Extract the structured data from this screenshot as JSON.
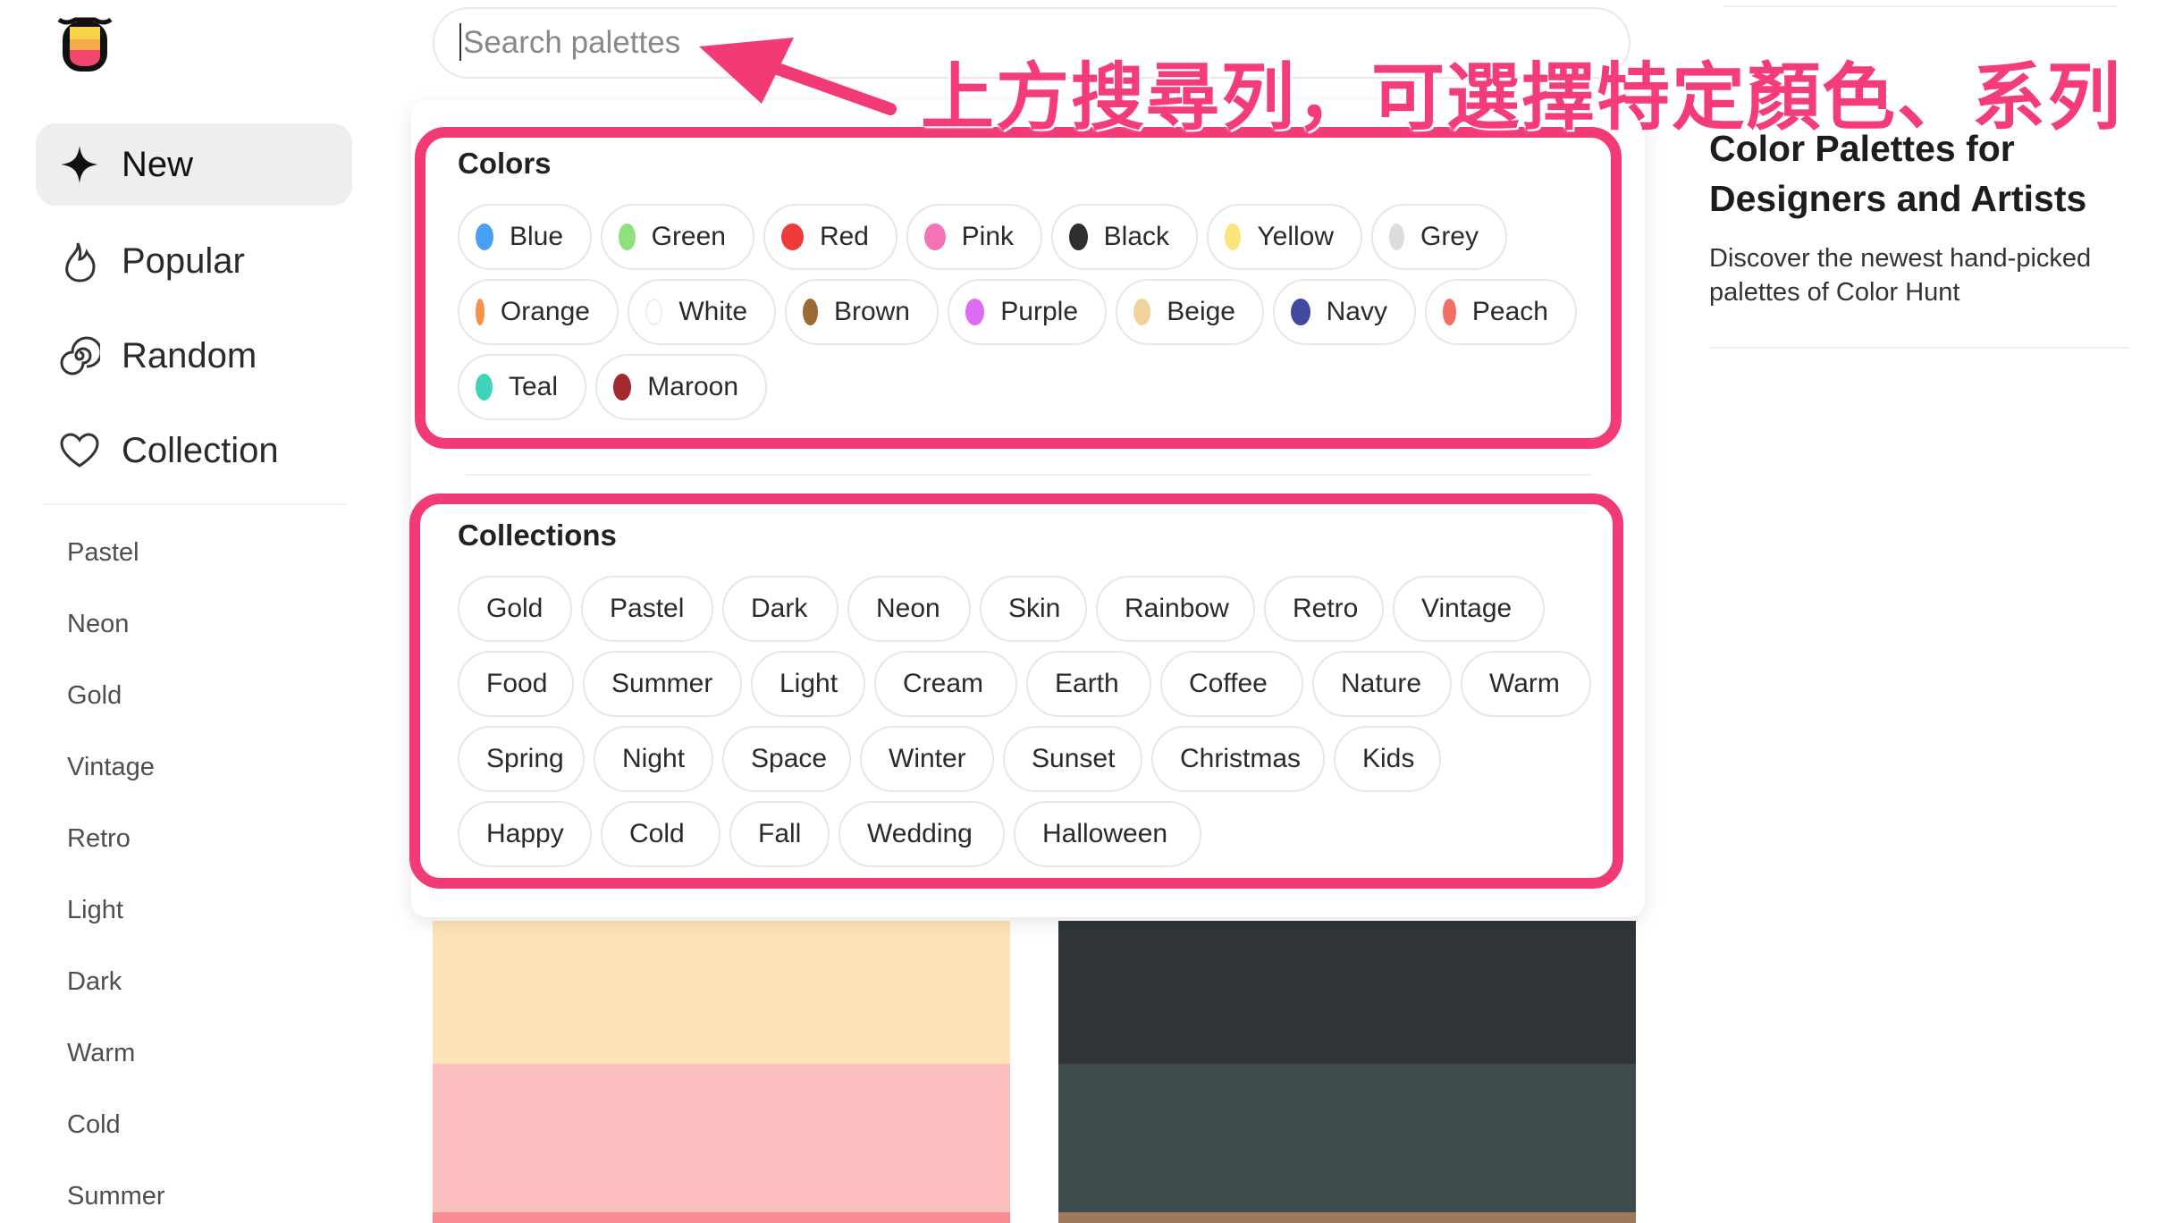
{
  "search": {
    "placeholder": "Search palettes"
  },
  "annotation": {
    "text": "上方搜尋列，可選擇特定顏色、系列"
  },
  "nav": [
    {
      "label": "New",
      "icon": "sparkle-icon",
      "active": true
    },
    {
      "label": "Popular",
      "icon": "flame-icon",
      "active": false
    },
    {
      "label": "Random",
      "icon": "spiral-icon",
      "active": false
    },
    {
      "label": "Collection",
      "icon": "heart-icon",
      "active": false
    }
  ],
  "sidebar_links": [
    "Pastel",
    "Neon",
    "Gold",
    "Vintage",
    "Retro",
    "Light",
    "Dark",
    "Warm",
    "Cold",
    "Summer"
  ],
  "colors_section": {
    "title": "Colors",
    "items": [
      {
        "label": "Blue",
        "color": "#4a9ff5"
      },
      {
        "label": "Green",
        "color": "#8fe07a"
      },
      {
        "label": "Red",
        "color": "#f03a3a"
      },
      {
        "label": "Pink",
        "color": "#f572b8"
      },
      {
        "label": "Black",
        "color": "#2f2f2f"
      },
      {
        "label": "Yellow",
        "color": "#fbe47a"
      },
      {
        "label": "Grey",
        "color": "#dcdcdc"
      },
      {
        "label": "Orange",
        "color": "#f5924a"
      },
      {
        "label": "White",
        "color": "#ffffff"
      },
      {
        "label": "Brown",
        "color": "#9a6b34"
      },
      {
        "label": "Purple",
        "color": "#dd6cf3"
      },
      {
        "label": "Beige",
        "color": "#f1d3a0"
      },
      {
        "label": "Navy",
        "color": "#3f4a9e"
      },
      {
        "label": "Peach",
        "color": "#f36f63"
      },
      {
        "label": "Teal",
        "color": "#3fd4b9"
      },
      {
        "label": "Maroon",
        "color": "#a32a2a"
      }
    ]
  },
  "collections_section": {
    "title": "Collections",
    "items": [
      "Gold",
      "Pastel",
      "Dark",
      "Neon",
      "Skin",
      "Rainbow",
      "Retro",
      "Vintage",
      "Food",
      "Summer",
      "Light",
      "Cream",
      "Earth",
      "Coffee",
      "Nature",
      "Warm",
      "Spring",
      "Night",
      "Space",
      "Winter",
      "Sunset",
      "Christmas",
      "Kids",
      "Happy",
      "Cold",
      "Fall",
      "Wedding",
      "Halloween"
    ]
  },
  "info": {
    "title": "Color Palettes for Designers and Artists",
    "description": "Discover the newest hand-picked palettes of Color Hunt"
  },
  "palettes": [
    {
      "colors": [
        "#fde4b8",
        "#fcbfbf",
        "#f98c93"
      ]
    },
    {
      "colors": [
        "#2f3538",
        "#3f4c4e",
        "#9d7859"
      ]
    }
  ],
  "accent": "#f23a74"
}
